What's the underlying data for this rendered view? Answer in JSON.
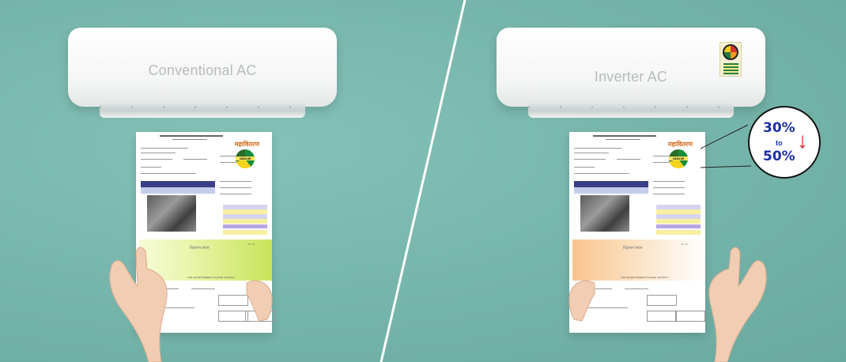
{
  "left_panel": {
    "ac_label": "Conventional AC",
    "bill": {
      "brand": "महावितरण",
      "banner_title": "विज्ञापन स्थान",
      "ad_line": "FOR ADVERTISEMENT PLEASE CONTACT",
      "rating": "1933.00"
    }
  },
  "right_panel": {
    "ac_label": "Inverter AC",
    "bill": {
      "brand": "महावितरण",
      "banner_title": "विज्ञापन स्थान",
      "ad_line": "FOR ADVERTISEMENT PLEASE CONTACT",
      "rating": "1933.00"
    },
    "callout": {
      "top": "30%",
      "middle": "to",
      "bottom": "50%",
      "arrow": "↓"
    }
  },
  "colors": {
    "background": "#7ab8ae",
    "callout_text": "#1c2fa8",
    "arrow": "#e0232b"
  },
  "icons": [
    "energy-star-sticker-icon",
    "down-arrow-icon",
    "hand-icon"
  ]
}
